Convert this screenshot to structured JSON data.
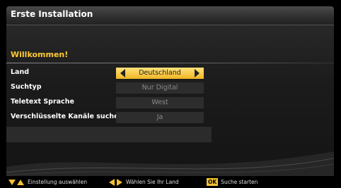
{
  "window": {
    "title": "Erste Installation"
  },
  "welcome": "Willkommen!",
  "settings": [
    {
      "label": "Land",
      "value": "Deutschland",
      "active": true
    },
    {
      "label": "Suchtyp",
      "value": "Nur Digital",
      "active": false
    },
    {
      "label": "Teletext Sprache",
      "value": "West",
      "active": false
    },
    {
      "label": "Verschlüsselte Kanäle suchen",
      "value": "Ja",
      "active": false
    }
  ],
  "footer": {
    "select_setting": "Einstellung auswählen",
    "choose_country": "Wählen Sie Ihr Land",
    "ok_key": "OK",
    "start_search": "Suche starten"
  },
  "colors": {
    "accent": "#f2c12e",
    "highlight": "#ffe27a",
    "heading": "#ffcc33"
  },
  "icons": {
    "up_down": [
      "arrow-down-icon",
      "arrow-up-icon"
    ],
    "left_right": [
      "arrow-left-icon",
      "arrow-right-icon"
    ]
  }
}
